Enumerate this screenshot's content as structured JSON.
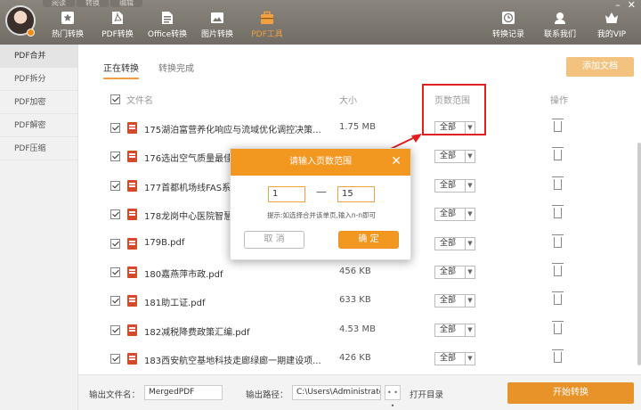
{
  "window_tabs": [
    "阅读",
    "转换",
    "编辑"
  ],
  "window_controls": {
    "minimize": "–",
    "close": "✕"
  },
  "nav_left": [
    {
      "label": "热门转换",
      "icon": "star-icon"
    },
    {
      "label": "PDF转换",
      "icon": "pdf-icon"
    },
    {
      "label": "Office转换",
      "icon": "office-icon"
    },
    {
      "label": "图片转换",
      "icon": "image-icon"
    },
    {
      "label": "PDF工具",
      "icon": "toolbox-icon"
    }
  ],
  "nav_right": [
    {
      "label": "转换记录",
      "icon": "clock-icon"
    },
    {
      "label": "联系我们",
      "icon": "contact-icon"
    },
    {
      "label": "我的VIP",
      "icon": "crown-icon"
    }
  ],
  "sidebar": {
    "items": [
      {
        "label": "PDF合并"
      },
      {
        "label": "PDF拆分"
      },
      {
        "label": "PDF加密"
      },
      {
        "label": "PDF解密"
      },
      {
        "label": "PDF压缩"
      }
    ]
  },
  "tabs": {
    "active": "正在转换",
    "done": "转换完成"
  },
  "add_button": "添加文档",
  "columns": {
    "name": "文件名",
    "size": "大小",
    "range": "页数范围",
    "actions": "操作"
  },
  "rows": [
    {
      "name": "175湖泊富营养化响应与流域优化调控决策...",
      "size": "1.75 MB",
      "range": "全部"
    },
    {
      "name": "176选出空气质量最佳",
      "size": "",
      "range": "全部"
    },
    {
      "name": "177首都机场线FAS系统",
      "size": "",
      "range": "全部"
    },
    {
      "name": "178龙岗中心医院智慧",
      "size": "",
      "range": "全部"
    },
    {
      "name": "179B.pdf",
      "size": "",
      "range": "全部"
    },
    {
      "name": "180嘉燕萍市政.pdf",
      "size": "456 KB",
      "range": "全部"
    },
    {
      "name": "181助工证.pdf",
      "size": "633 KB",
      "range": "全部"
    },
    {
      "name": "182减税降费政策汇编.pdf",
      "size": "4.53 MB",
      "range": "全部"
    },
    {
      "name": "183西安航空基地科技走廊绿廊一期建设项...",
      "size": "426 KB",
      "range": "全部"
    }
  ],
  "footer": {
    "output_name_label": "输出文件名：",
    "output_name_value": "MergedPDF",
    "output_path_label": "输出路径：",
    "output_path_value": "C:\\Users\\Administrator",
    "browse": "• • •",
    "open_dir": "打开目录",
    "start": "开始转换"
  },
  "modal": {
    "title": "请输入页数范围",
    "close": "✕",
    "from": "1",
    "dash": "—",
    "to": "15",
    "hint": "提示:如选择合并该单页,输入n-n即可",
    "cancel": "取 消",
    "ok": "确 定"
  },
  "colors": {
    "accent": "#f2971f",
    "highlight": "#e02020",
    "header": "#7a756d"
  }
}
